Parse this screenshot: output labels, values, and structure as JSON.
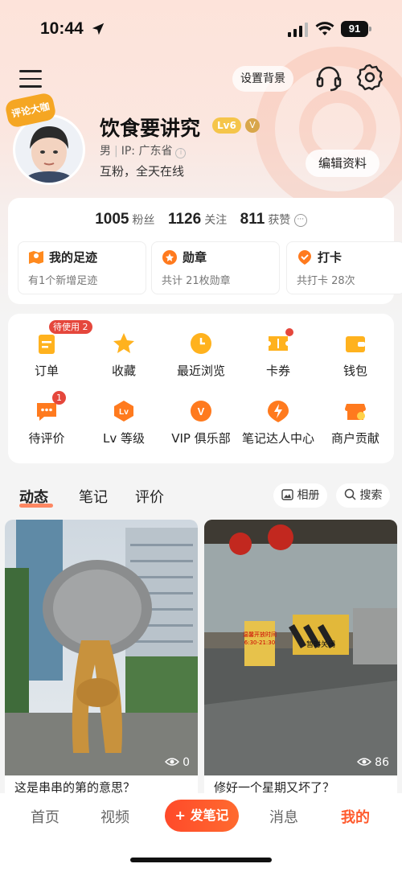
{
  "status": {
    "time": "10:44",
    "battery": "91"
  },
  "header": {
    "set_background": "设置背景"
  },
  "profile": {
    "badge": "评论大咖",
    "username": "饮食要讲究",
    "level": "Lv6",
    "gender": "男",
    "ip": "IP: 广东省",
    "bio": "互粉，全天在线",
    "edit_label": "编辑资料"
  },
  "stats": [
    {
      "num": "1005",
      "label": "粉丝"
    },
    {
      "num": "1126",
      "label": "关注"
    },
    {
      "num": "811",
      "label": "获赞"
    }
  ],
  "tiles": [
    {
      "title": "我的足迹",
      "sub": "有1个新增足迹"
    },
    {
      "title": "勋章",
      "sub": "共计 21枚勋章"
    },
    {
      "title": "打卡",
      "sub": "共打卡 28次"
    }
  ],
  "grid": [
    {
      "label": "订单",
      "badge": "待使用 2"
    },
    {
      "label": "收藏"
    },
    {
      "label": "最近浏览"
    },
    {
      "label": "卡券"
    },
    {
      "label": "钱包"
    },
    {
      "label": "待评价",
      "badge": "1"
    },
    {
      "label": "Lv 等级",
      "icon_text": "Lv"
    },
    {
      "label": "VIP 俱乐部",
      "icon_text": "V"
    },
    {
      "label": "笔记达人中心"
    },
    {
      "label": "商户贡献"
    }
  ],
  "tabs": [
    "动态",
    "笔记",
    "评价"
  ],
  "chips": {
    "album": "相册",
    "search": "搜索"
  },
  "feed": [
    {
      "views": "0",
      "caption": "这是串串的第的意思？"
    },
    {
      "views": "86",
      "caption": "修好一个星期又坏了？"
    }
  ],
  "feed_sign": {
    "line1": "温馨开放时间",
    "line2": "6:30-21:30",
    "line3": "暂时关闭"
  },
  "nav": {
    "home": "首页",
    "video": "视频",
    "post": "+ 发笔记",
    "messages": "消息",
    "mine": "我的"
  },
  "colors": {
    "accent": "#ff5b2e",
    "badge_red": "#e5473c",
    "icon_orange": "#ff8a1e"
  }
}
